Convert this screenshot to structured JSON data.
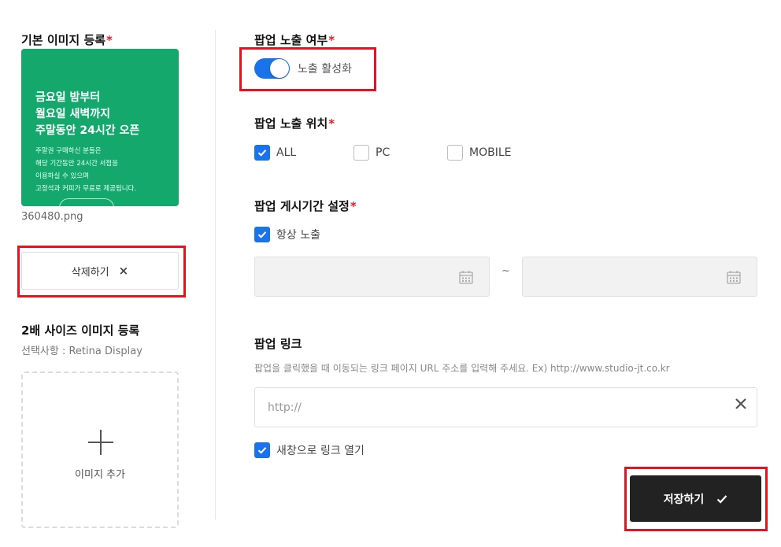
{
  "left": {
    "default_image_title": "기본 이미지 등록",
    "required_mark": "*",
    "banner": {
      "headline": [
        "금요일 밤부터",
        "월요일 새벽까지",
        "주말동안 24시간 오픈"
      ],
      "body": [
        "주말권 구매하신 분들은",
        "해당 기간동안 24시간 서점을",
        "이용하실 수 있으며",
        "고정석과 커피가 무료로 제공됩니다."
      ],
      "bg_color": "#14a86d"
    },
    "filename": "360480.png",
    "delete_label": "삭제하기",
    "delete_icon": "×",
    "retina_title": "2배 사이즈 이미지 등록",
    "retina_desc": "선택사항 : Retina Display",
    "add_image_label": "이미지 추가"
  },
  "right": {
    "popup_show_title": "팝업 노출 여부",
    "toggle_label": "노출 활성화",
    "toggle_on": true,
    "position_title": "팝업 노출 위치",
    "positions": [
      {
        "label": "ALL",
        "checked": true
      },
      {
        "label": "PC",
        "checked": false
      },
      {
        "label": "MOBILE",
        "checked": false
      }
    ],
    "period_title": "팝업 게시기간 설정",
    "always_label": "항상 노출",
    "always_checked": true,
    "date_separator": "~",
    "link_title": "팝업 링크",
    "link_desc": "팝업을 클릭했을 때 이동되는 링크 페이지 URL 주소를 입력해 주세요. Ex) http://www.studio-jt.co.kr",
    "url_placeholder": "http://",
    "new_window_label": "새창으로 링크 열기",
    "new_window_checked": true,
    "save_label": "저장하기"
  },
  "colors": {
    "accent": "#1a73e8",
    "required": "#e11d2a",
    "highlight": "#e3141f",
    "save_bg": "#222222"
  }
}
